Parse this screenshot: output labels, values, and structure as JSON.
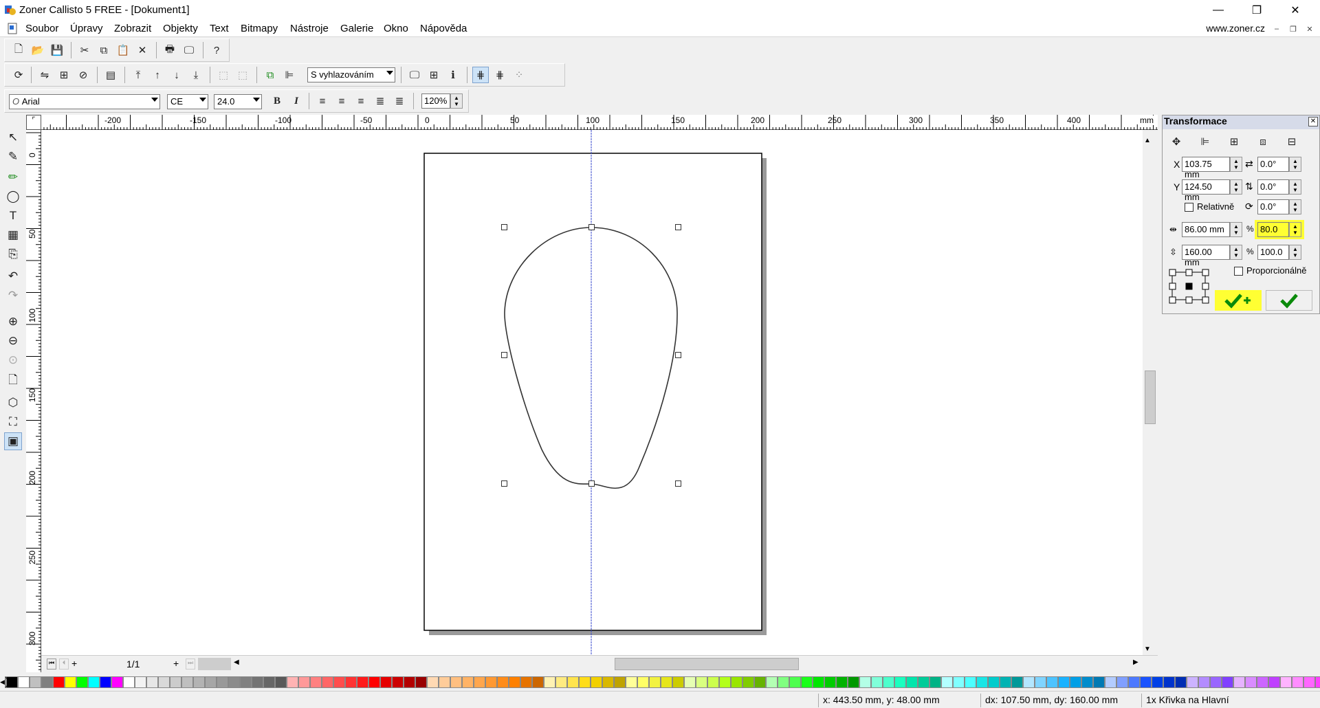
{
  "window": {
    "title": "Zoner Callisto 5 FREE - [Dokument1]",
    "minimize": "—",
    "restore": "❐",
    "close": "✕"
  },
  "menu": {
    "items": [
      "Soubor",
      "Úpravy",
      "Zobrazit",
      "Objekty",
      "Text",
      "Bitmapy",
      "Nástroje",
      "Galerie",
      "Okno",
      "Nápověda"
    ],
    "site": "www.zoner.cz",
    "mdi_min": "–",
    "mdi_restore": "❐",
    "mdi_close": "✕"
  },
  "toolbar2": {
    "smoothing": "S vyhlazováním"
  },
  "toolbar3": {
    "font": "Arial",
    "encoding": "CE",
    "size": "24.0",
    "bold": "B",
    "italic": "I",
    "zoom": "120%"
  },
  "hruler": {
    "unit": "mm",
    "labels": [
      "-200",
      "-150",
      "-100",
      "-50",
      "0",
      "50",
      "100",
      "150",
      "200",
      "250",
      "300",
      "350",
      "400"
    ]
  },
  "vruler": {
    "labels": [
      "0",
      "50",
      "100",
      "150",
      "200",
      "250",
      "300"
    ]
  },
  "pager": {
    "page": "1/1"
  },
  "transform": {
    "title": "Transformace",
    "x_label": "X",
    "x_value": "103.75 mm",
    "y_label": "Y",
    "y_value": "124.50 mm",
    "rot1": "0.0°",
    "rot2": "0.0°",
    "rot3": "0.0°",
    "relative_label": "Relativně",
    "width_value": "86.00 mm",
    "width_pct": "80.0",
    "height_value": "160.00 mm",
    "height_pct": "100.0",
    "pct_symbol": "%",
    "proportional_label": "Proporcionálně"
  },
  "status": {
    "coords": "x: 443.50 mm, y: 48.00 mm",
    "delta": "dx: 107.50 mm, dy: 160.00 mm",
    "selection": "1x Křivka na Hlavní"
  },
  "palette": [
    "#000000",
    "#ffffff",
    "#c0c0c0",
    "#808080",
    "#ff0000",
    "#ffff00",
    "#00ff00",
    "#00ffff",
    "#0000ff",
    "#ff00ff",
    "#ffffff",
    "#f2f2f2",
    "#e6e6e6",
    "#d9d9d9",
    "#cccccc",
    "#bfbfbf",
    "#b3b3b3",
    "#a6a6a6",
    "#999999",
    "#8c8c8c",
    "#808080",
    "#737373",
    "#666666",
    "#595959",
    "#ffb3b3",
    "#ff9999",
    "#ff8080",
    "#ff6666",
    "#ff4d4d",
    "#ff3333",
    "#ff1a1a",
    "#ff0000",
    "#e60000",
    "#cc0000",
    "#b30000",
    "#990000",
    "#ffd9b3",
    "#ffcc99",
    "#ffbf80",
    "#ffb366",
    "#ffa64d",
    "#ff9933",
    "#ff8c1a",
    "#ff8000",
    "#e67300",
    "#cc6600",
    "#fff2b3",
    "#ffeb80",
    "#ffe44d",
    "#ffdd1a",
    "#f2d000",
    "#d9b800",
    "#bfa300",
    "#ffff99",
    "#ffff66",
    "#f2f240",
    "#e6e61a",
    "#cccc00",
    "#e6ffb3",
    "#d9ff80",
    "#ccff4d",
    "#b3ff1a",
    "#99e600",
    "#80cc00",
    "#66b300",
    "#b3ffb3",
    "#80ff80",
    "#4dff4d",
    "#1aff1a",
    "#00e600",
    "#00cc00",
    "#00b300",
    "#009900",
    "#b3ffe6",
    "#80ffd9",
    "#4dffcc",
    "#1affbf",
    "#00e6ac",
    "#00cc99",
    "#00b386",
    "#b3ffff",
    "#80ffff",
    "#4dffff",
    "#1ae6e6",
    "#00cccc",
    "#00b3b3",
    "#009999",
    "#b3e6ff",
    "#80d4ff",
    "#4dc3ff",
    "#1ab2ff",
    "#009fe6",
    "#008ccc",
    "#0079b3",
    "#b3ccff",
    "#809fff",
    "#4d79ff",
    "#1a53ff",
    "#0040e6",
    "#0033cc",
    "#002db3",
    "#ccb3ff",
    "#b38cff",
    "#9966ff",
    "#8040ff",
    "#e6b3ff",
    "#d98cff",
    "#cc66ff",
    "#bf40ff",
    "#ffb3ff",
    "#ff8cff",
    "#ff66ff",
    "#ff40ff",
    "#ffb3e6"
  ]
}
